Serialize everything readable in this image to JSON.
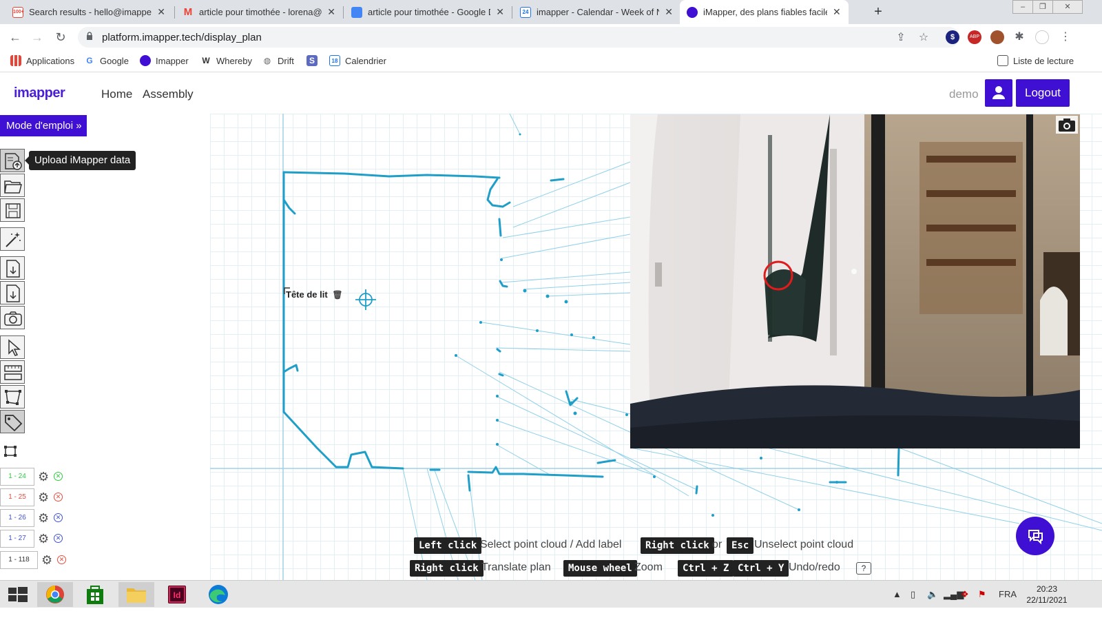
{
  "browser": {
    "tabs": [
      {
        "title": "Search results - hello@imapper.te",
        "icon": "gmail-icon",
        "color": "#ea4335"
      },
      {
        "title": "article pour timothée - lorena@ir",
        "icon": "gmail-icon",
        "color": "#ea4335"
      },
      {
        "title": "article pour timothée - Google D",
        "icon": "google-docs-icon",
        "color": "#4285f4"
      },
      {
        "title": "imapper - Calendar - Week of Nc",
        "icon": "calendar-icon",
        "color": "#1a73e8"
      },
      {
        "title": "iMapper, des plans fiables facilen",
        "icon": "imapper-icon",
        "color": "#3f0fd3"
      }
    ],
    "gmail_badge": "100+",
    "calendar_badge": "24",
    "url": "platform.imapper.tech/display_plan",
    "bookmarks": [
      "Applications",
      "Google",
      "Imapper",
      "Whereby",
      "Drift",
      "",
      "Calendrier"
    ],
    "bookmark_icons": {
      "s_letter": "S",
      "cal_number": "18",
      "whereby_letter": "W"
    },
    "reading_list": "Liste de lecture",
    "ext_badge": "ABP"
  },
  "app": {
    "logo": "imapper",
    "nav": [
      "Home",
      "Assembly"
    ],
    "user": "demo",
    "logout_label": "Logout",
    "mode_emploi": "Mode d'emploi »",
    "tooltip": "Upload iMapper data",
    "label_on_plan": "Tête de lit",
    "point_clouds": [
      {
        "id": "1 - 24",
        "status_color": "#2ecc40",
        "text_color": "#2ecc40"
      },
      {
        "id": "1 - 25",
        "status_color": "#e74c3c",
        "text_color": "#e74c3c"
      },
      {
        "id": "1 - 26",
        "status_color": "#3f51d6",
        "text_color": "#3f51d6"
      },
      {
        "id": "1 - 27",
        "status_color": "#3f51d6",
        "text_color": "#3f51d6"
      },
      {
        "id": "1 - 118",
        "status_color": "#e74c3c",
        "text_color": "#555"
      }
    ],
    "hints": {
      "left_click_key": "Left click",
      "left_click_text": "Select point cloud / Add label",
      "right_click_key": "Right click",
      "or_text": "or",
      "esc_key": "Esc",
      "unselect_text": "Unselect point cloud",
      "right_click_key2": "Right click",
      "translate_text": "Translate plan",
      "wheel_key": "Mouse wheel",
      "zoom_text": "Zoom",
      "ctrlz_key": "Ctrl + Z",
      "ctrly_key": "Ctrl + Y",
      "undo_text": "Undo/redo",
      "help": "?"
    },
    "colors": {
      "accent": "#3f0fd3",
      "plan_line": "#1f9ec8",
      "grid": "#e4eef5"
    }
  },
  "taskbar": {
    "language": "FRA",
    "time": "20:23",
    "date": "22/11/2021"
  }
}
